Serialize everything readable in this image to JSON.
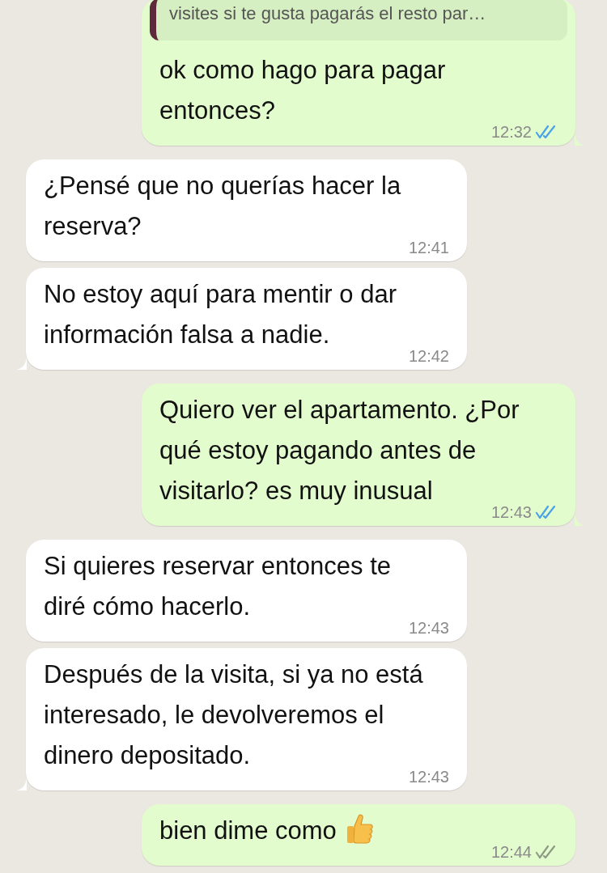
{
  "messages": [
    {
      "kind": "sent",
      "quote": "visites si te gusta pagarás el resto par…",
      "text": "ok como hago para pagar entonces?",
      "time": "12:32",
      "read": true,
      "tail": true
    },
    {
      "kind": "received",
      "text": "¿Pensé que no querías hacer la reserva?",
      "time": "12:41",
      "tail": false
    },
    {
      "kind": "received",
      "text": "No estoy aquí para mentir o dar información falsa a nadie.",
      "time": "12:42",
      "tail": true
    },
    {
      "kind": "sent",
      "text": "Quiero ver el apartamento. ¿Por qué estoy pagando antes de visitarlo? es muy inusual",
      "time": "12:43",
      "read": true,
      "tail": true
    },
    {
      "kind": "received",
      "text": "Si quieres reservar entonces te diré cómo hacerlo.",
      "time": "12:43",
      "tail": false
    },
    {
      "kind": "received",
      "text": "Después de la visita, si ya no está interesado, le devolveremos el dinero depositado.",
      "time": "12:43",
      "tail": true
    },
    {
      "kind": "sent",
      "text": "bien dime como",
      "thumbs_icon": true,
      "time": "12:44",
      "read": false,
      "tail": false
    }
  ]
}
